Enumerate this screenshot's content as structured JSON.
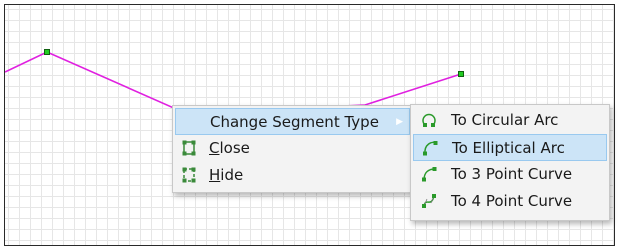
{
  "context_menu": {
    "items": [
      {
        "label": "Change Segment Type",
        "has_submenu": true,
        "highlighted": true
      },
      {
        "label_mnemonic": "C",
        "label_rest": "lose",
        "icon": "close-path-icon"
      },
      {
        "label_mnemonic": "H",
        "label_rest": "ide",
        "icon": "hide-icon"
      }
    ]
  },
  "submenu": {
    "items": [
      {
        "label": "To Circular Arc",
        "icon": "circular-arc-icon"
      },
      {
        "label": "To Elliptical Arc",
        "icon": "elliptical-arc-icon",
        "highlighted": true
      },
      {
        "label": "To 3 Point Curve",
        "icon": "three-point-curve-icon"
      },
      {
        "label": "To 4 Point Curve",
        "icon": "four-point-curve-icon"
      }
    ]
  },
  "colors": {
    "segment_line": "#e020e0",
    "vertex_handle": "#22cc22",
    "menu_highlight": "#cce4f7",
    "grid": "#e6e6e6"
  }
}
